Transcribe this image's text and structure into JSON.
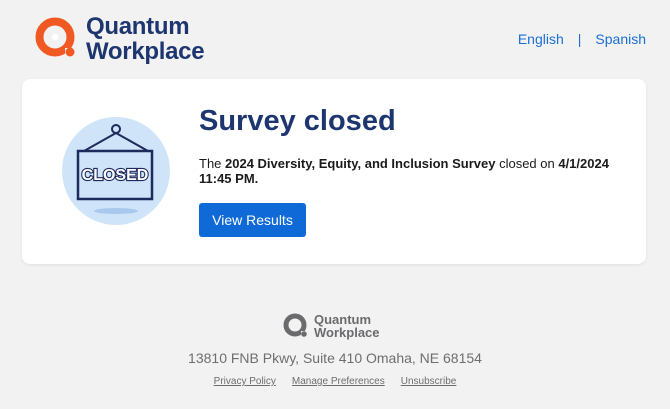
{
  "header": {
    "logo_line1": "Quantum",
    "logo_line2": "Workplace",
    "languages": [
      "English",
      "Spanish"
    ],
    "lang_separator": "|"
  },
  "card": {
    "title": "Survey closed",
    "illustration_sign_text": "CLOSED",
    "desc_prefix": "The ",
    "survey_name": "2024 Diversity, Equity, and Inclusion Survey",
    "desc_middle": " closed on ",
    "closed_date": "4/1/2024 11:45 PM.",
    "button_label": "View Results"
  },
  "footer": {
    "logo_line1": "Quantum",
    "logo_line2": "Workplace",
    "address": "13810 FNB Pkwy, Suite 410 Omaha, NE 68154",
    "links": [
      "Privacy Policy",
      "Manage Preferences",
      "Unsubscribe"
    ]
  },
  "colors": {
    "brand_orange": "#f05a22",
    "brand_navy": "#1d3670",
    "button_blue": "#0f6ad8",
    "link_blue": "#1a6fd4"
  }
}
